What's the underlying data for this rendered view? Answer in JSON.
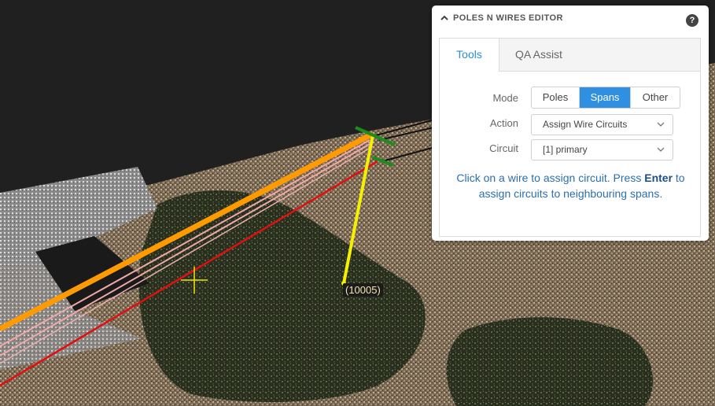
{
  "viewport": {
    "pole_label": "(10005)"
  },
  "panel": {
    "title": "POLES N WIRES EDITOR",
    "help_glyph": "?",
    "collapse_icon": "chevron-up-icon",
    "tabs": [
      {
        "label": "Tools",
        "active": true
      },
      {
        "label": "QA Assist",
        "active": false
      }
    ],
    "mode": {
      "label": "Mode",
      "options": [
        "Poles",
        "Spans",
        "Other"
      ],
      "selected": "Spans"
    },
    "action": {
      "label": "Action",
      "value": "Assign Wire Circuits"
    },
    "circuit": {
      "label": "Circuit",
      "value": "[1] primary"
    },
    "instructions": {
      "before": "Click on a wire to assign circuit. Press",
      "key": "Enter",
      "after": "to assign circuits to neighbouring spans."
    }
  },
  "colors": {
    "accent": "#2f8fe0",
    "wire_primary": "#ff9a00",
    "wire_secondary": "#f0a8a8",
    "wire_red": "#e01010",
    "pole_selected": "#f4f000",
    "crosshair": "#f2e400"
  }
}
